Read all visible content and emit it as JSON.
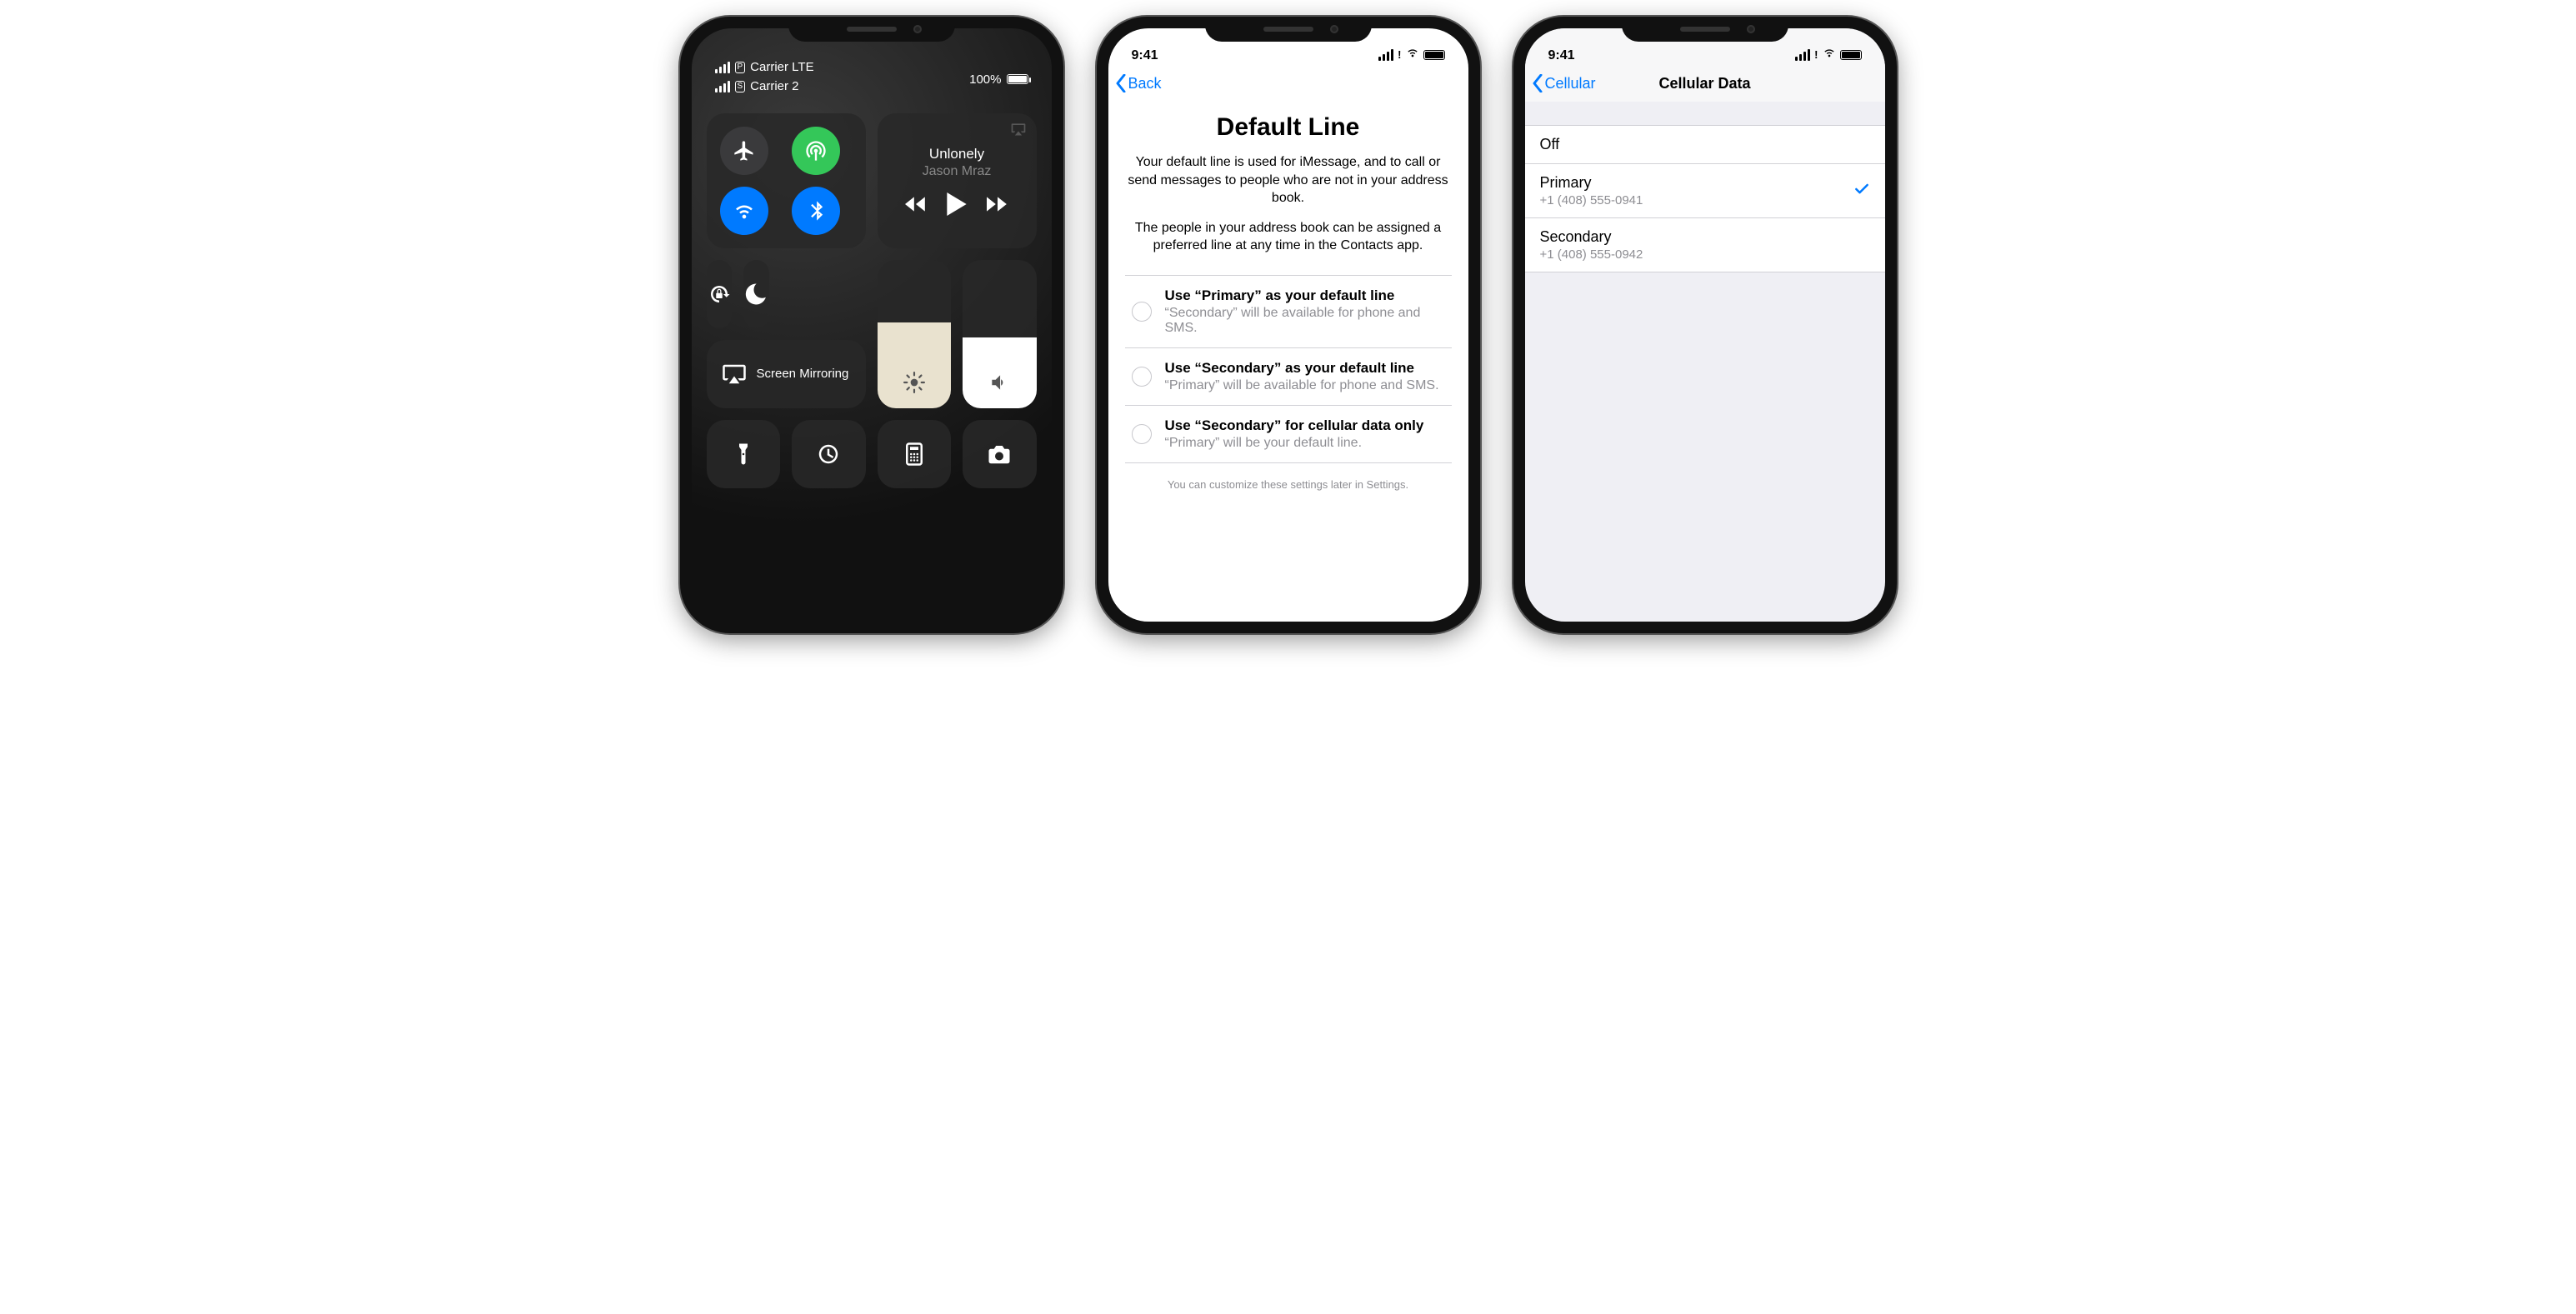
{
  "phone1": {
    "status": {
      "carrier1_sim": "P",
      "carrier1_text": "Carrier  LTE",
      "carrier2_sim": "S",
      "carrier2_text": "Carrier 2",
      "battery_pct": "100%"
    },
    "media": {
      "title": "Unlonely",
      "artist": "Jason Mraz"
    },
    "screen_mirroring": "Screen Mirroring"
  },
  "phone2": {
    "time": "9:41",
    "back": "Back",
    "title": "Default Line",
    "desc1": "Your default line is used for iMessage, and to call or send messages to people who are not in your address book.",
    "desc2": "The people in your address book can be assigned a preferred line at any time in the Contacts app.",
    "options": [
      {
        "title": "Use “Primary” as your default line",
        "sub": "“Secondary” will be available for phone and SMS."
      },
      {
        "title": "Use “Secondary” as your default line",
        "sub": "“Primary” will be available for phone and SMS."
      },
      {
        "title": "Use “Secondary” for cellular data only",
        "sub": "“Primary” will be your default line."
      }
    ],
    "footnote": "You can customize these settings later in Settings."
  },
  "phone3": {
    "time": "9:41",
    "back": "Cellular",
    "title": "Cellular Data",
    "rows": [
      {
        "title": "Off",
        "sub": "",
        "checked": false
      },
      {
        "title": "Primary",
        "sub": "+1 (408) 555-0941",
        "checked": true
      },
      {
        "title": "Secondary",
        "sub": "+1 (408) 555-0942",
        "checked": false
      }
    ]
  }
}
